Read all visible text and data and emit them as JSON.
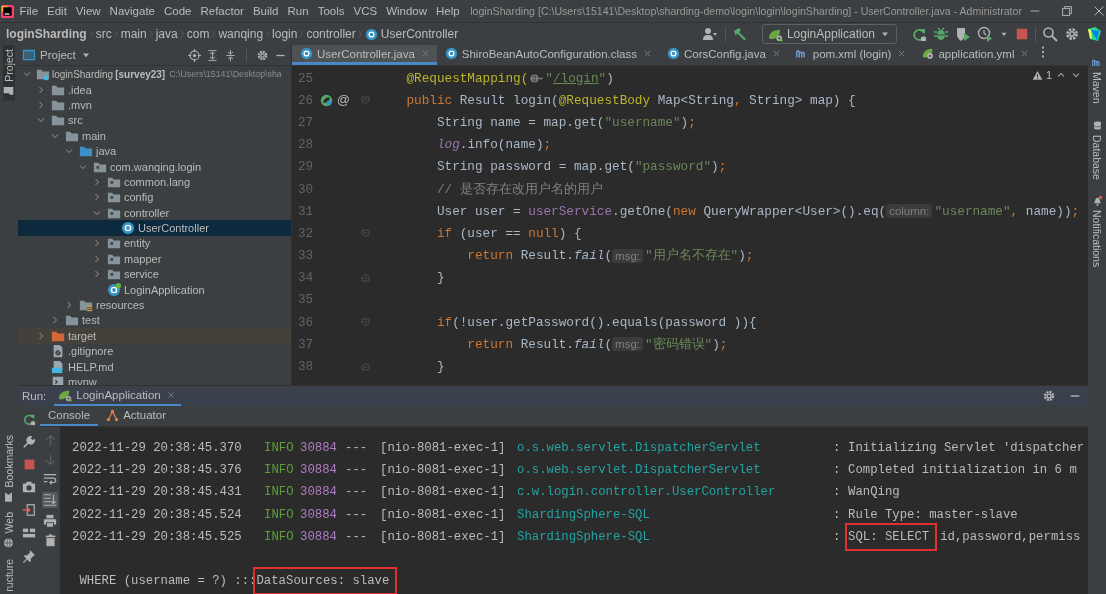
{
  "window": {
    "title": "loginSharding [C:\\Users\\15141\\Desktop\\sharding-demo\\login\\login\\loginSharding] - UserController.java - Administrator"
  },
  "menu": [
    "File",
    "Edit",
    "View",
    "Navigate",
    "Code",
    "Refactor",
    "Build",
    "Run",
    "Tools",
    "VCS",
    "Window",
    "Help"
  ],
  "breadcrumbs": [
    {
      "label": "loginSharding",
      "kind": "project"
    },
    {
      "label": "src",
      "kind": "dir"
    },
    {
      "label": "main",
      "kind": "dir"
    },
    {
      "label": "java",
      "kind": "dir"
    },
    {
      "label": "com",
      "kind": "dir"
    },
    {
      "label": "wanqing",
      "kind": "dir"
    },
    {
      "label": "login",
      "kind": "dir"
    },
    {
      "label": "controller",
      "kind": "dir"
    },
    {
      "label": "UserController",
      "kind": "class"
    }
  ],
  "run_config": {
    "label": "LoginApplication"
  },
  "left_tool_windows_top": [
    {
      "label": "Project",
      "kind": "project"
    }
  ],
  "left_tool_windows_bottom": [
    {
      "label": "Bookmarks",
      "kind": "bookmarks"
    },
    {
      "label": "Web",
      "kind": "web"
    },
    {
      "label": "ructure",
      "kind": "structure"
    }
  ],
  "right_tool_windows": [
    {
      "label": "Maven",
      "kind": "maven"
    },
    {
      "label": "Database",
      "kind": "database"
    },
    {
      "label": "Notifications",
      "kind": "notifications"
    }
  ],
  "project_panel": {
    "title": "Project",
    "tree": [
      {
        "label": "loginSharding",
        "module": "[survey23]",
        "path": "C:\\Users\\15141\\Desktop\\sha",
        "kind": "module",
        "expanded": true,
        "selected": false,
        "children": [
          {
            "label": ".idea",
            "kind": "folder",
            "expanded": false,
            "selected": false
          },
          {
            "label": ".mvn",
            "kind": "folder",
            "expanded": false,
            "selected": false
          },
          {
            "label": "src",
            "kind": "folder",
            "expanded": true,
            "selected": false,
            "children": [
              {
                "label": "main",
                "kind": "folder",
                "expanded": true,
                "selected": false,
                "children": [
                  {
                    "label": "java",
                    "kind": "source",
                    "expanded": true,
                    "selected": false,
                    "children": [
                      {
                        "label": "com.wanqing.login",
                        "kind": "package",
                        "expanded": true,
                        "selected": false,
                        "children": [
                          {
                            "label": "common.lang",
                            "kind": "package",
                            "expanded": false,
                            "selected": false
                          },
                          {
                            "label": "config",
                            "kind": "package",
                            "expanded": false,
                            "selected": false
                          },
                          {
                            "label": "controller",
                            "kind": "package",
                            "expanded": true,
                            "selected": false,
                            "children": [
                              {
                                "label": "UserController",
                                "kind": "class",
                                "selected": true
                              }
                            ]
                          },
                          {
                            "label": "entity",
                            "kind": "package",
                            "expanded": false,
                            "selected": false
                          },
                          {
                            "label": "mapper",
                            "kind": "package",
                            "expanded": false,
                            "selected": false
                          },
                          {
                            "label": "service",
                            "kind": "package",
                            "expanded": false,
                            "selected": false
                          },
                          {
                            "label": "LoginApplication",
                            "kind": "app",
                            "selected": false
                          }
                        ]
                      }
                    ]
                  },
                  {
                    "label": "resources",
                    "kind": "resources",
                    "expanded": false,
                    "selected": false
                  }
                ]
              },
              {
                "label": "test",
                "kind": "folder",
                "expanded": false,
                "selected": false
              }
            ]
          },
          {
            "label": "target",
            "kind": "excluded",
            "expanded": false,
            "selected": false
          },
          {
            "label": ".gitignore",
            "kind": "gitignore",
            "selected": false
          },
          {
            "label": "HELP.md",
            "kind": "markdown",
            "selected": false
          },
          {
            "label": "mvnw",
            "kind": "script",
            "selected": false
          }
        ]
      }
    ]
  },
  "editor": {
    "tabs": [
      {
        "label": "UserController.java",
        "kind": "class",
        "selected": true
      },
      {
        "label": "ShiroBeanAutoConfiguration.class",
        "kind": "class",
        "selected": false
      },
      {
        "label": "CorsConfig.java",
        "kind": "class",
        "selected": false
      },
      {
        "label": "pom.xml (login)",
        "kind": "maven",
        "selected": false
      },
      {
        "label": "application.yml",
        "kind": "yaml",
        "selected": false
      }
    ],
    "warnings": "1",
    "lines": [
      {
        "number": "25",
        "tokens": [
          {
            "kind": "annotation",
            "text": "    @RequestMapping("
          },
          {
            "kind": "url-icon"
          },
          {
            "kind": "string",
            "text": "\""
          },
          {
            "kind": "url",
            "text": "/login"
          },
          {
            "kind": "string",
            "text": "\""
          },
          {
            "kind": "plain",
            "text": ")"
          }
        ]
      },
      {
        "number": "26",
        "fold_start": true,
        "gutter": [
          {
            "kind": "bean"
          },
          {
            "kind": "text",
            "text": "@"
          }
        ],
        "tokens": [
          {
            "kind": "keyword",
            "text": "    public"
          },
          {
            "kind": "plain",
            "text": " Result login("
          },
          {
            "kind": "annotation",
            "text": "@RequestBody"
          },
          {
            "kind": "plain",
            "text": " Map<String"
          },
          {
            "kind": "keyword",
            "text": ","
          },
          {
            "kind": "plain",
            "text": " String> map) {"
          }
        ]
      },
      {
        "number": "27",
        "tokens": [
          {
            "kind": "plain",
            "text": "        String name = map.get("
          },
          {
            "kind": "string",
            "text": "\"username\""
          },
          {
            "kind": "plain",
            "text": ")"
          },
          {
            "kind": "keyword",
            "text": ";"
          }
        ]
      },
      {
        "number": "28",
        "tokens": [
          {
            "kind": "static-field",
            "text": "        log"
          },
          {
            "kind": "plain",
            "text": ".info(name)"
          },
          {
            "kind": "keyword",
            "text": ";"
          }
        ]
      },
      {
        "number": "29",
        "tokens": [
          {
            "kind": "plain",
            "text": "        String password = map.get("
          },
          {
            "kind": "string",
            "text": "\"password\""
          },
          {
            "kind": "plain",
            "text": ")"
          },
          {
            "kind": "keyword",
            "text": ";"
          }
        ]
      },
      {
        "number": "30",
        "tokens": [
          {
            "kind": "comment",
            "text": "        // 是否存在改用户名的用户"
          }
        ]
      },
      {
        "number": "31",
        "tokens": [
          {
            "kind": "plain",
            "text": "        User user = "
          },
          {
            "kind": "field",
            "text": "userService"
          },
          {
            "kind": "plain",
            "text": ".getOne("
          },
          {
            "kind": "keyword",
            "text": "new"
          },
          {
            "kind": "plain",
            "text": " QueryWrapper<User>().eq("
          },
          {
            "kind": "inlay",
            "text": "column:"
          },
          {
            "kind": "string",
            "text": "\"username\""
          },
          {
            "kind": "keyword",
            "text": ","
          },
          {
            "kind": "plain",
            "text": " name))"
          },
          {
            "kind": "keyword",
            "text": ";"
          }
        ]
      },
      {
        "number": "32",
        "fold_start": true,
        "tokens": [
          {
            "kind": "keyword",
            "text": "        if"
          },
          {
            "kind": "plain",
            "text": " (user == "
          },
          {
            "kind": "keyword",
            "text": "null"
          },
          {
            "kind": "plain",
            "text": ") {"
          }
        ]
      },
      {
        "number": "33",
        "tokens": [
          {
            "kind": "keyword",
            "text": "            return"
          },
          {
            "kind": "plain",
            "text": " Result."
          },
          {
            "kind": "static-method",
            "text": "fail"
          },
          {
            "kind": "plain",
            "text": "("
          },
          {
            "kind": "inlay",
            "text": "msg:"
          },
          {
            "kind": "string",
            "text": "\"用户名不存在\""
          },
          {
            "kind": "plain",
            "text": ")"
          },
          {
            "kind": "keyword",
            "text": ";"
          }
        ]
      },
      {
        "number": "34",
        "fold_end": true,
        "tokens": [
          {
            "kind": "plain",
            "text": "        }"
          }
        ]
      },
      {
        "number": "35"
      },
      {
        "number": "36",
        "fold_start": true,
        "tokens": [
          {
            "kind": "keyword",
            "text": "        if"
          },
          {
            "kind": "plain",
            "text": "(!user.getPassword().equals(password )){"
          }
        ]
      },
      {
        "number": "37",
        "tokens": [
          {
            "kind": "keyword",
            "text": "            return"
          },
          {
            "kind": "plain",
            "text": " Result."
          },
          {
            "kind": "static-method",
            "text": "fail"
          },
          {
            "kind": "plain",
            "text": "("
          },
          {
            "kind": "inlay",
            "text": "msg:"
          },
          {
            "kind": "string",
            "text": "\"密码错误\""
          },
          {
            "kind": "plain",
            "text": ")"
          },
          {
            "kind": "keyword",
            "text": ";"
          }
        ]
      },
      {
        "number": "38",
        "fold_end": true,
        "tokens": [
          {
            "kind": "plain",
            "text": "        }"
          }
        ]
      }
    ]
  },
  "run_panel": {
    "label": "Run:",
    "tabs": [
      {
        "label": "LoginApplication",
        "selected": true
      }
    ],
    "console_tabs": [
      {
        "label": "Console",
        "kind": "console",
        "selected": true
      },
      {
        "label": "Actuator",
        "kind": "actuator",
        "selected": false
      }
    ],
    "autoscroll": true,
    "log": [
      {
        "kind": "entry",
        "timestamp": "2022-11-29 20:38:45.370",
        "level": "INFO",
        "pid": "30884",
        "dashes": "---",
        "thread": "[nio-8081-exec-1]",
        "logger": "o.s.web.servlet.DispatcherServlet",
        "colon": ":",
        "message": [
          {
            "t": "Initializing Servlet 'dispatcher",
            "highlight": false
          }
        ]
      },
      {
        "kind": "entry",
        "timestamp": "2022-11-29 20:38:45.376",
        "level": "INFO",
        "pid": "30884",
        "dashes": "---",
        "thread": "[nio-8081-exec-1]",
        "logger": "o.s.web.servlet.DispatcherServlet",
        "colon": ":",
        "message": [
          {
            "t": "Completed initialization in 6 m",
            "highlight": false
          }
        ]
      },
      {
        "kind": "entry",
        "timestamp": "2022-11-29 20:38:45.431",
        "level": "INFO",
        "pid": "30884",
        "dashes": "---",
        "thread": "[nio-8081-exec-1]",
        "logger": "c.w.login.controller.UserController",
        "colon": ":",
        "message": [
          {
            "t": "WanQing",
            "highlight": false
          }
        ]
      },
      {
        "kind": "entry",
        "timestamp": "2022-11-29 20:38:45.524",
        "level": "INFO",
        "pid": "30884",
        "dashes": "---",
        "thread": "[nio-8081-exec-1]",
        "logger": "ShardingSphere-SQL",
        "colon": ":",
        "message": [
          {
            "t": "Rule Type: master-slave",
            "highlight": false
          }
        ]
      },
      {
        "kind": "entry",
        "timestamp": "2022-11-29 20:38:45.525",
        "level": "INFO",
        "pid": "30884",
        "dashes": "---",
        "thread": "[nio-8081-exec-1]",
        "logger": "ShardingSphere-SQL",
        "colon": ":",
        "message": [
          {
            "t": "SQL: SELECT",
            "highlight": true
          },
          {
            "t": "id,password,permiss",
            "highlight": false
          }
        ]
      },
      {
        "kind": "blank"
      },
      {
        "kind": "continuation",
        "message": [
          {
            "t": " WHERE (username = ?) :::",
            "highlight": false
          },
          {
            "t": "DataSources: slave",
            "highlight": true
          }
        ]
      }
    ]
  }
}
